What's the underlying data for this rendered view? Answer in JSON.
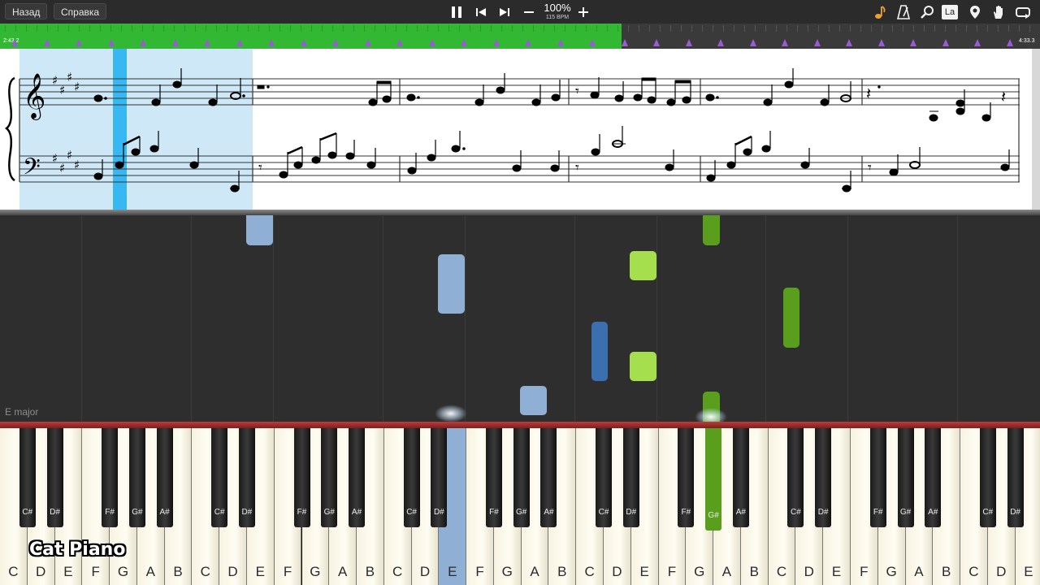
{
  "toolbar": {
    "back_label": "Назад",
    "help_label": "Справка",
    "tempo_percent": "100%",
    "tempo_bpm": "115 BPM",
    "icons": [
      "pause-icon",
      "skip-back-icon",
      "skip-forward-icon",
      "minus-icon",
      "plus-icon",
      "note-icon",
      "metronome-icon",
      "magnifier-icon",
      "la-icon",
      "map-pin-icon",
      "hand-icon",
      "loop-icon"
    ],
    "la_label": "La"
  },
  "progress": {
    "elapsed": "2:43.2",
    "total": "4:33.3",
    "fraction": 0.598
  },
  "roll": {
    "key_signature_label": "E major"
  },
  "keyboard": {
    "white_keys": [
      "C",
      "D",
      "E",
      "F",
      "G",
      "A",
      "B",
      "C",
      "D",
      "E",
      "F",
      "G",
      "A",
      "B",
      "C",
      "D",
      "E",
      "F",
      "G",
      "A",
      "B",
      "C",
      "D",
      "E",
      "F",
      "G",
      "A",
      "B",
      "C",
      "D",
      "E",
      "F",
      "G",
      "A",
      "B",
      "C",
      "D",
      "E"
    ],
    "black_keys": [
      "C#",
      "D#",
      "F#",
      "G#",
      "A#",
      "C#",
      "D#",
      "F#",
      "G#",
      "A#",
      "C#",
      "D#",
      "F#",
      "G#",
      "A#",
      "C#",
      "D#",
      "F#",
      "G#",
      "A#",
      "C#",
      "D#",
      "F#",
      "G#",
      "A#",
      "C#",
      "D#",
      "F#",
      "G#",
      "A#",
      "C#",
      "D#"
    ],
    "active_left_hand": "E",
    "active_right_hand": "G#"
  },
  "watermark": "Cat Piano",
  "colors": {
    "left_hand": "#8fb0d4",
    "left_hand_dark": "#3b6fb0",
    "right_hand": "#a5df4e",
    "right_hand_dark": "#5a9e1e",
    "progress": "#33b833",
    "highlight": "#cfe8f8"
  }
}
